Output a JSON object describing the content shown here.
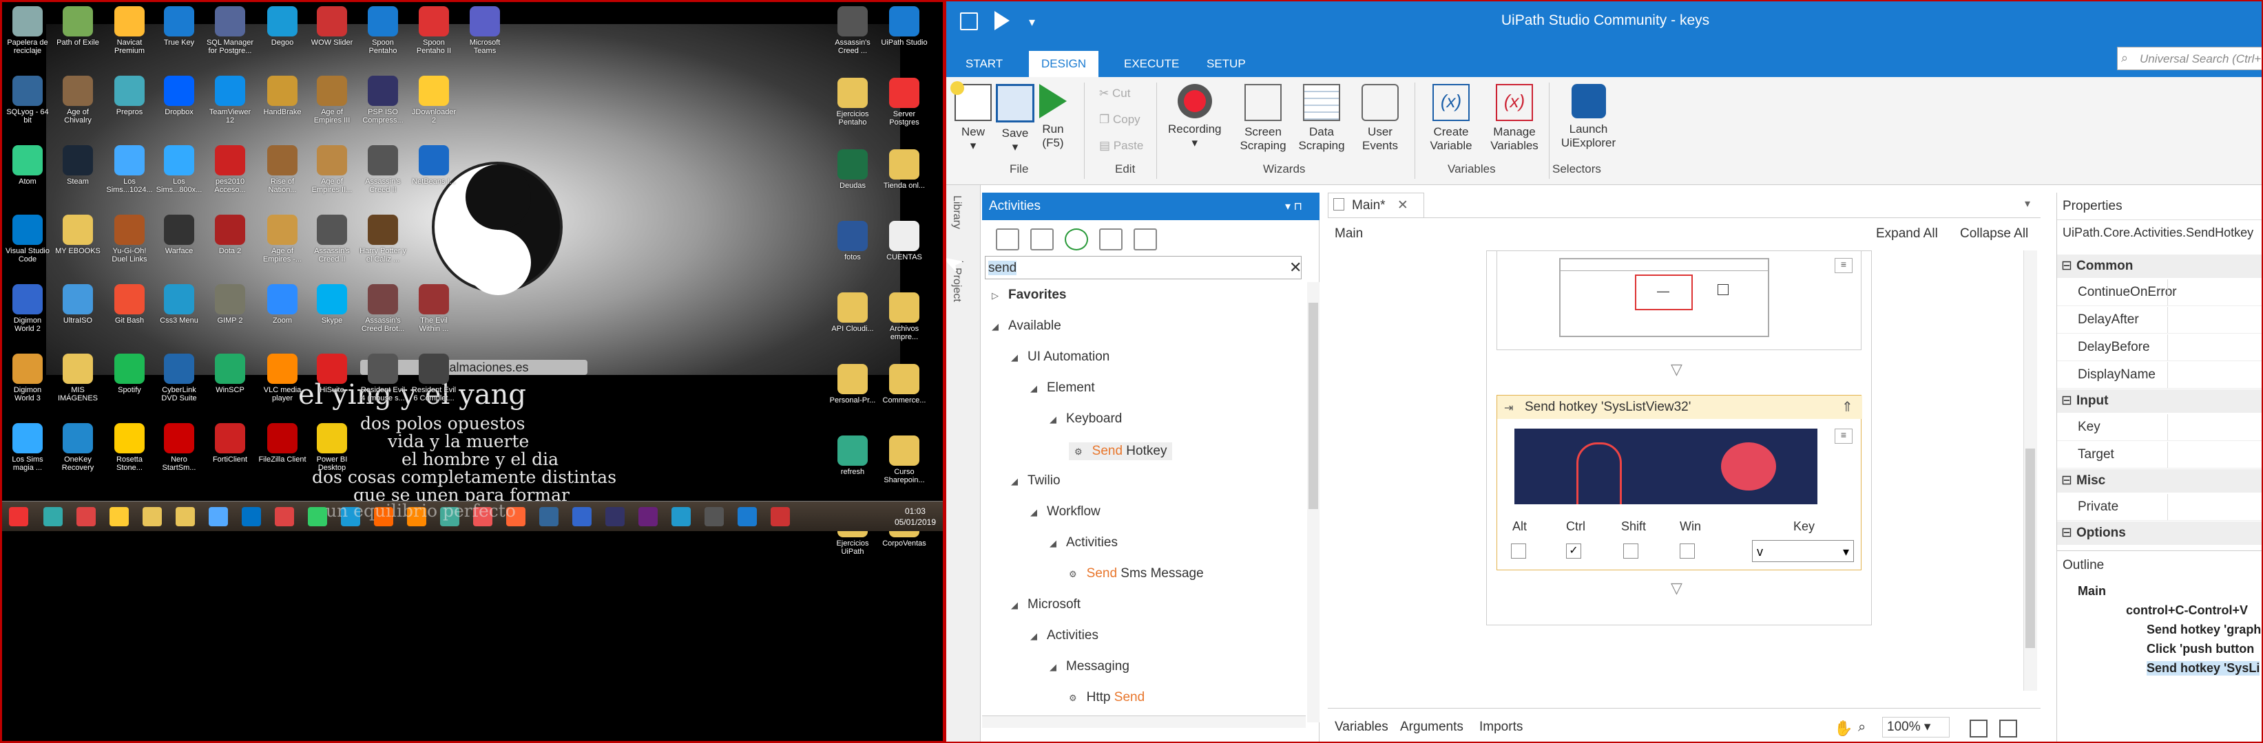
{
  "desktop": {
    "wallpaper_banner": "sumaalmaciones.es",
    "poem_lines": [
      "el ying y el yang",
      "dos polos opuestos",
      "vida y la muerte",
      "el hombre y el dia",
      "dos cosas completamente distintas",
      "que se unen para formar",
      "un equilibrio perfecto"
    ],
    "icons": [
      {
        "label": "Papelera de reciclaje",
        "color": "#8aa"
      },
      {
        "label": "Path of Exile",
        "color": "#7a5"
      },
      {
        "label": "Navicat Premium",
        "color": "#fb3"
      },
      {
        "label": "True Key",
        "color": "#1a7bd1"
      },
      {
        "label": "SQL Manager for Postgre...",
        "color": "#569"
      },
      {
        "label": "Degoo",
        "color": "#1a9ad6"
      },
      {
        "label": "WOW Slider",
        "color": "#c33"
      },
      {
        "label": "Spoon Pentaho",
        "color": "#1a7bd1"
      },
      {
        "label": "Spoon Pentaho II",
        "color": "#d33"
      },
      {
        "label": "Microsoft Teams",
        "color": "#5b5fc7"
      },
      {
        "label": "SQLyog - 64 bit",
        "color": "#369"
      },
      {
        "label": "Age of Chivalry",
        "color": "#864"
      },
      {
        "label": "Prepros",
        "color": "#4ab"
      },
      {
        "label": "Dropbox",
        "color": "#0061fe"
      },
      {
        "label": "TeamViewer 12",
        "color": "#0e8ee9"
      },
      {
        "label": "HandBrake",
        "color": "#c93"
      },
      {
        "label": "Age of Empires III",
        "color": "#a73"
      },
      {
        "label": "PSP ISO Compress...",
        "color": "#336"
      },
      {
        "label": "JDownloader 2",
        "color": "#fc3"
      },
      {
        "label": "Atom",
        "color": "#3c8"
      },
      {
        "label": "Steam",
        "color": "#1b2838"
      },
      {
        "label": "Los Sims...1024...",
        "color": "#4af"
      },
      {
        "label": "Los Sims...800x...",
        "color": "#3af"
      },
      {
        "label": "pes2010 Acceso...",
        "color": "#c22"
      },
      {
        "label": "Rise of Nation...",
        "color": "#963"
      },
      {
        "label": "Age of Empires II...",
        "color": "#b84"
      },
      {
        "label": "Assassin's Creed II",
        "color": "#555"
      },
      {
        "label": "NetBeans I...",
        "color": "#1b6ac6"
      },
      {
        "label": "Visual Studio Code",
        "color": "#007acc"
      },
      {
        "label": "MY EBOOKS",
        "color": "#e8c45a"
      },
      {
        "label": "Yu-Gi-Oh! Duel Links",
        "color": "#a52"
      },
      {
        "label": "Warface",
        "color": "#333"
      },
      {
        "label": "Dota 2",
        "color": "#a22"
      },
      {
        "label": "Age of Empires -...",
        "color": "#c94"
      },
      {
        "label": "Assassin's Creed II",
        "color": "#555"
      },
      {
        "label": "Harry Potter y el Cáliz ...",
        "color": "#642"
      },
      {
        "label": "Digimon World 2",
        "color": "#36c"
      },
      {
        "label": "UltraISO",
        "color": "#49d"
      },
      {
        "label": "Git Bash",
        "color": "#f05033"
      },
      {
        "label": "Css3 Menu",
        "color": "#29c"
      },
      {
        "label": "GIMP 2",
        "color": "#776"
      },
      {
        "label": "Zoom",
        "color": "#2d8cff"
      },
      {
        "label": "Skype",
        "color": "#00aff0"
      },
      {
        "label": "Assassin's Creed Brot...",
        "color": "#744"
      },
      {
        "label": "The Evil Within ...",
        "color": "#933"
      },
      {
        "label": "Digimon World 3",
        "color": "#d93"
      },
      {
        "label": "MIS IMÁGENES",
        "color": "#e8c45a"
      },
      {
        "label": "Spotify",
        "color": "#1db954"
      },
      {
        "label": "CyberLink DVD Suite",
        "color": "#26a"
      },
      {
        "label": "WinSCP",
        "color": "#2a6"
      },
      {
        "label": "VLC media player",
        "color": "#f80"
      },
      {
        "label": "HiSuite",
        "color": "#d22"
      },
      {
        "label": "Resident Evil 4 (mouse s...",
        "color": "#555"
      },
      {
        "label": "Resident Evil 6 Complet...",
        "color": "#444"
      },
      {
        "label": "Los Sims magia ...",
        "color": "#3af"
      },
      {
        "label": "OneKey Recovery",
        "color": "#28c"
      },
      {
        "label": "Rosetta Stone...",
        "color": "#fc0"
      },
      {
        "label": "Nero StartSm...",
        "color": "#c00"
      },
      {
        "label": "FortiClient",
        "color": "#c22"
      },
      {
        "label": "FileZilla Client",
        "color": "#bf0000"
      },
      {
        "label": "Power BI Desktop",
        "color": "#f2c811"
      },
      {
        "label": "Assassin's Creed ...",
        "color": "#555"
      },
      {
        "label": "UiPath Studio",
        "color": "#1a7bd1"
      },
      {
        "label": "Ejercicios Pentaho",
        "color": "#e8c45a"
      },
      {
        "label": "Server Postgres",
        "color": "#e33"
      },
      {
        "label": "Deudas",
        "color": "#1e7145"
      },
      {
        "label": "Tienda onl...",
        "color": "#e8c45a"
      },
      {
        "label": "fotos",
        "color": "#2b579a"
      },
      {
        "label": "CUENTAS",
        "color": "#eee"
      },
      {
        "label": "API Cloudi...",
        "color": "#e8c45a"
      },
      {
        "label": "Archivos empre...",
        "color": "#e8c45a"
      },
      {
        "label": "Personal-Pr...",
        "color": "#e8c45a"
      },
      {
        "label": "Commerce...",
        "color": "#e8c45a"
      },
      {
        "label": "refresh",
        "color": "#3a8"
      },
      {
        "label": "Curso Sharepoin...",
        "color": "#e8c45a"
      },
      {
        "label": "Ejercicios UiPath",
        "color": "#e8c45a"
      },
      {
        "label": "CorpoVentas",
        "color": "#e8c45a"
      }
    ],
    "taskbar": {
      "apps": [
        "#3aa",
        "#d44",
        "#fc3",
        "#e8c45a",
        "#e8c45a",
        "#5af",
        "#0072c6",
        "#d44",
        "#3c6",
        "#1a9ad6",
        "#f60",
        "#f80",
        "#4a9",
        "#e55",
        "#f63",
        "#369",
        "#36c",
        "#336",
        "#68217a",
        "#29c",
        "#555",
        "#1a7bd1",
        "#c33"
      ],
      "time": "01:03",
      "date": "05/01/2019"
    }
  },
  "studio": {
    "window_title": "UiPath Studio Community - keys",
    "tabs": [
      "START",
      "DESIGN",
      "EXECUTE",
      "SETUP"
    ],
    "active_tab": "DESIGN",
    "search_placeholder": "Universal Search (Ctrl+",
    "ribbon": {
      "new": "New",
      "save": "Save",
      "run": "Run",
      "run_key": "(F5)",
      "cut": "Cut",
      "copy": "Copy",
      "paste": "Paste",
      "recording": "Recording",
      "screen_scraping": "Screen Scraping",
      "data_scraping": "Data Scraping",
      "user_events": "User Events",
      "create_variable": "Create Variable",
      "manage_variables": "Manage Variables",
      "launch_uiexplorer": "Launch UiExplorer",
      "groups": {
        "file": "File",
        "edit": "Edit",
        "wizards": "Wizards",
        "variables": "Variables",
        "selectors": "Selectors"
      }
    },
    "side_tabs": [
      "Library",
      "Project"
    ],
    "activities": {
      "header": "Activities",
      "search": "send",
      "tree": [
        {
          "text": "Favorites",
          "hl": "",
          "indent": 0,
          "bold": true
        },
        {
          "text": "Available",
          "hl": "",
          "indent": 0
        },
        {
          "text": "UI Automation",
          "hl": "",
          "indent": 1
        },
        {
          "text": "Element",
          "hl": "",
          "indent": 2
        },
        {
          "text": "Keyboard",
          "hl": "",
          "indent": 3
        },
        {
          "text": " Hotkey",
          "hl": "Send",
          "indent": 4,
          "leaf": true
        },
        {
          "text": "Twilio",
          "hl": "",
          "indent": 1
        },
        {
          "text": "Workflow",
          "hl": "",
          "indent": 2
        },
        {
          "text": "Activities",
          "hl": "",
          "indent": 3
        },
        {
          "text": " Sms Message",
          "hl": "Send",
          "indent": 4,
          "leaf": true
        },
        {
          "text": "Microsoft",
          "hl": "",
          "indent": 1
        },
        {
          "text": "Activities",
          "hl": "",
          "indent": 2
        },
        {
          "text": "Messaging",
          "hl": "",
          "indent": 3
        },
        {
          "text": "Http ",
          "hl": "Send",
          "indent": 4,
          "leaf": true,
          "hl_after": true
        }
      ]
    },
    "designer": {
      "doc_tab": "Main*",
      "breadcrumb": "Main",
      "expand_all": "Expand All",
      "collapse_all": "Collapse All",
      "hotkey_title": "Send hotkey 'SysListView32'",
      "modifiers": [
        "Alt",
        "Ctrl",
        "Shift",
        "Win"
      ],
      "modifier_checked": [
        false,
        true,
        false,
        false
      ],
      "key_label": "Key",
      "key_value": "v",
      "bottom": {
        "variables": "Variables",
        "arguments": "Arguments",
        "imports": "Imports",
        "zoom": "100%"
      }
    },
    "properties": {
      "header": "Properties",
      "type": "UiPath.Core.Activities.SendHotkey",
      "categories": [
        {
          "name": "Common",
          "rows": [
            "ContinueOnError",
            "DelayAfter",
            "DelayBefore",
            "DisplayName"
          ]
        },
        {
          "name": "Input",
          "rows": [
            "Key",
            "Target"
          ]
        },
        {
          "name": "Misc",
          "rows": [
            "Private"
          ]
        },
        {
          "name": "Options",
          "rows": []
        }
      ]
    },
    "outline": {
      "header": "Outline",
      "items": [
        "Main",
        "control+C-Control+V",
        "Send hotkey 'graph",
        "Click 'push button",
        "Send hotkey 'SysLi"
      ]
    }
  }
}
